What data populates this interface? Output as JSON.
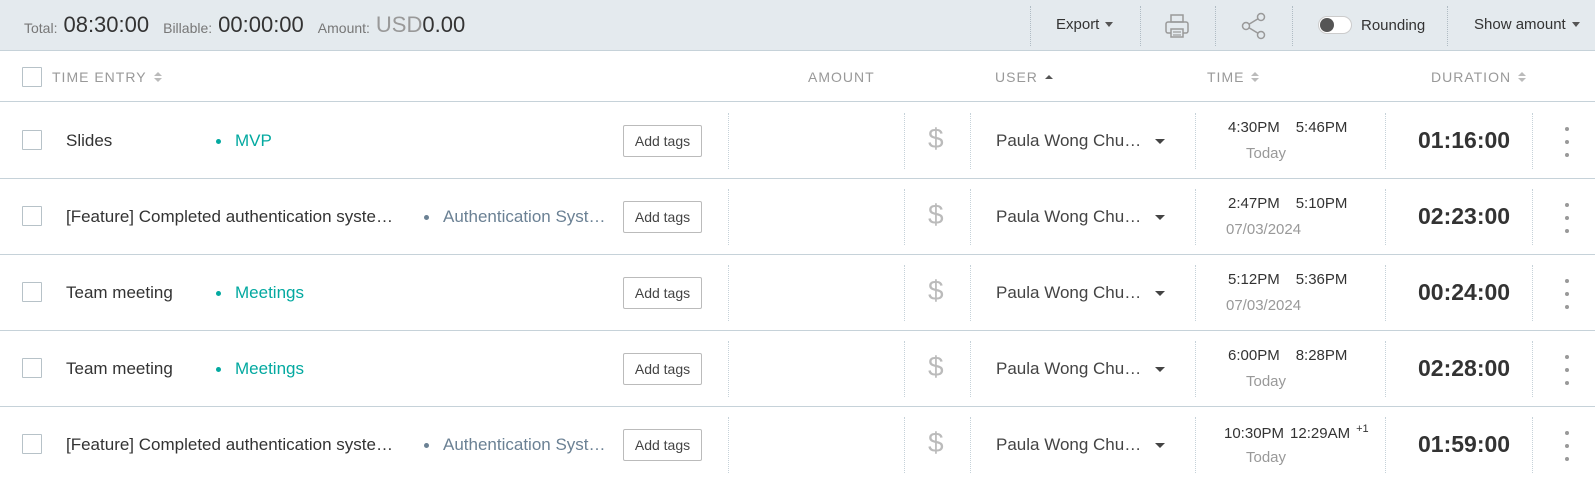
{
  "summary": {
    "total_label": "Total:",
    "total_value": "08:30:00",
    "billable_label": "Billable:",
    "billable_value": "00:00:00",
    "amount_label": "Amount:",
    "amount_currency": "USD",
    "amount_value": "0.00",
    "export_label": "Export",
    "print_icon": "printer-icon",
    "share_icon": "share-icon",
    "rounding_label": "Rounding",
    "rounding_on": false,
    "show_amount_label": "Show amount"
  },
  "columns": {
    "time_entry": "TIME ENTRY",
    "amount": "AMOUNT",
    "user": "USER",
    "time": "TIME",
    "duration": "DURATION"
  },
  "add_tags_label": "Add tags",
  "billable_icon": "dollar-icon",
  "colors": {
    "project_teal": "#03a9a0",
    "project_slate": "#6b8194",
    "header_bg": "#e4eaee"
  },
  "rows": [
    {
      "description": "Slides",
      "project": "MVP",
      "user": "Paula Wong Chu…",
      "start": "4:30PM",
      "end": "5:46PM",
      "end_suffix": "",
      "date": "Today",
      "duration": "01:16:00"
    },
    {
      "description": "[Feature] Completed authentication syste…",
      "project": "Authentication Syst…",
      "user": "Paula Wong Chu…",
      "start": "2:47PM",
      "end": "5:10PM",
      "end_suffix": "",
      "date": "07/03/2024",
      "duration": "02:23:00"
    },
    {
      "description": "Team meeting",
      "project": "Meetings",
      "user": "Paula Wong Chu…",
      "start": "5:12PM",
      "end": "5:36PM",
      "end_suffix": "",
      "date": "07/03/2024",
      "duration": "00:24:00"
    },
    {
      "description": "Team meeting",
      "project": "Meetings",
      "user": "Paula Wong Chu…",
      "start": "6:00PM",
      "end": "8:28PM",
      "end_suffix": "",
      "date": "Today",
      "duration": "02:28:00"
    },
    {
      "description": "[Feature] Completed authentication syste…",
      "project": "Authentication Syst…",
      "user": "Paula Wong Chu…",
      "start": "10:30PM",
      "end": "12:29AM",
      "end_suffix": "+1",
      "date": "Today",
      "duration": "01:59:00"
    }
  ]
}
